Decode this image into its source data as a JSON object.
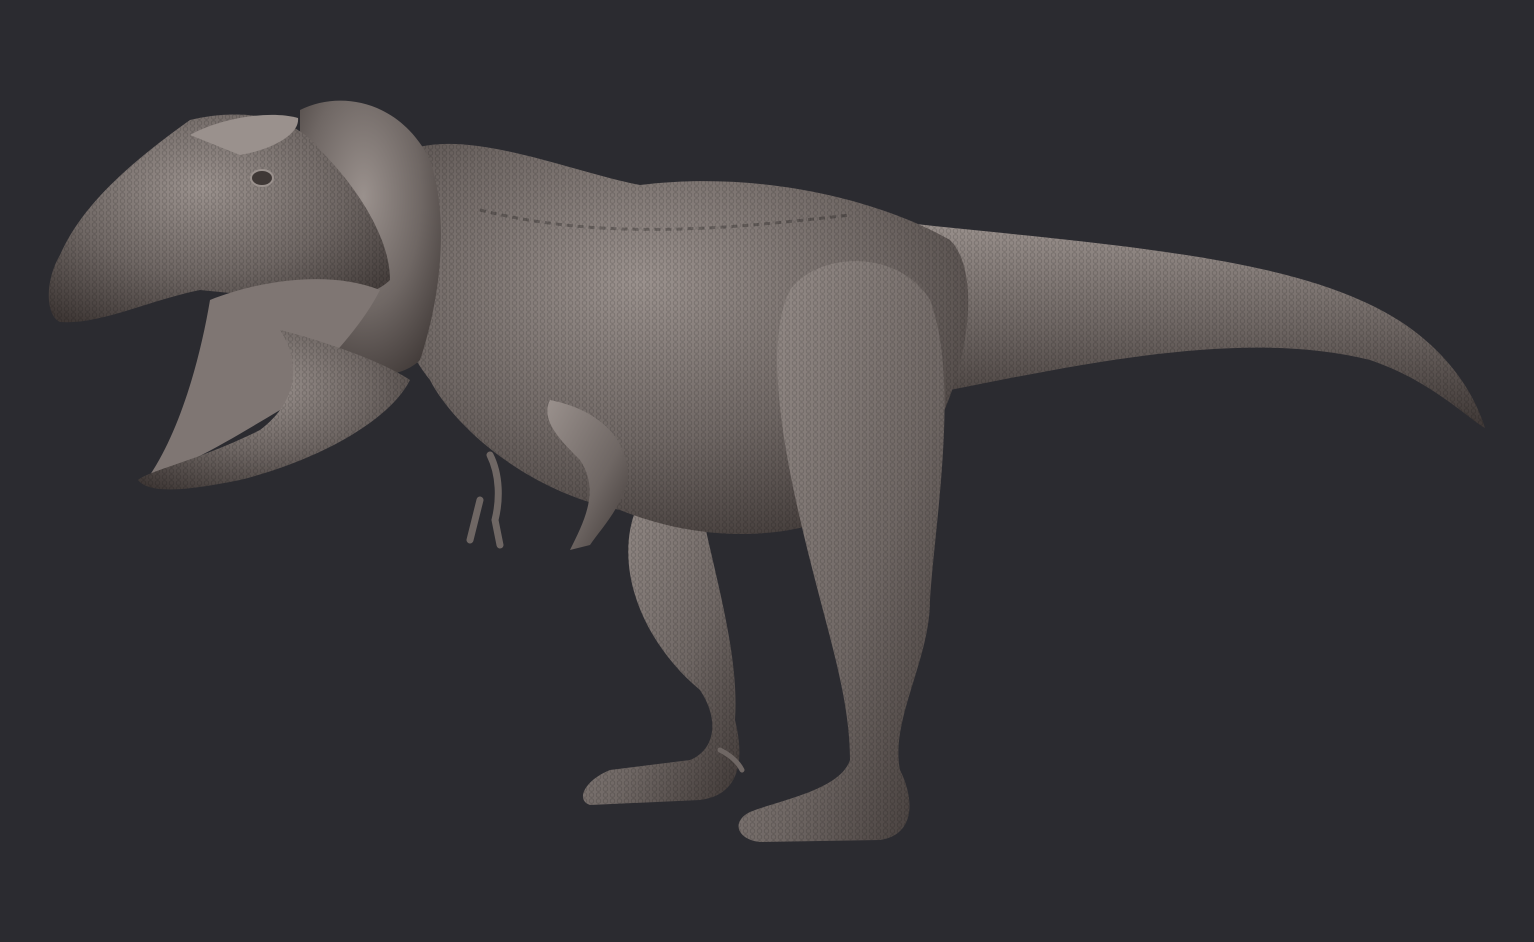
{
  "scene": {
    "subject": "",
    "background_color": "#2b2b30",
    "model_colors": {
      "base": "#6f6764",
      "highlight": "#9a918d",
      "shadow": "#3f3836",
      "mouth_interior": "#7f7673"
    }
  }
}
